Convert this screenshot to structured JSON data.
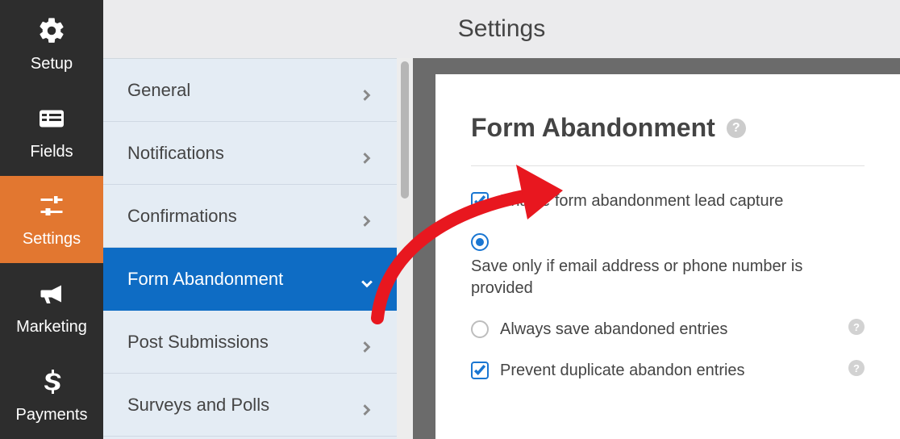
{
  "header": {
    "title": "Settings"
  },
  "sidebar": {
    "items": [
      {
        "label": "Setup"
      },
      {
        "label": "Fields"
      },
      {
        "label": "Settings"
      },
      {
        "label": "Marketing"
      },
      {
        "label": "Payments"
      }
    ],
    "active_index": 2
  },
  "settings_list": {
    "items": [
      {
        "label": "General"
      },
      {
        "label": "Notifications"
      },
      {
        "label": "Confirmations"
      },
      {
        "label": "Form Abandonment"
      },
      {
        "label": "Post Submissions"
      },
      {
        "label": "Surveys and Polls"
      }
    ],
    "active_index": 3
  },
  "panel": {
    "title": "Form Abandonment",
    "enable": {
      "label": "Enable form abandonment lead capture",
      "checked": true
    },
    "save_mode": {
      "options": [
        {
          "label": "Save only if email address or phone number is provided",
          "selected": true
        },
        {
          "label": "Always save abandoned entries",
          "selected": false
        }
      ]
    },
    "prevent_dup": {
      "label": "Prevent duplicate abandon entries",
      "checked": true
    }
  },
  "colors": {
    "accent": "#e27730",
    "primary": "#0e6cc4",
    "arrow": "#e8171f"
  }
}
